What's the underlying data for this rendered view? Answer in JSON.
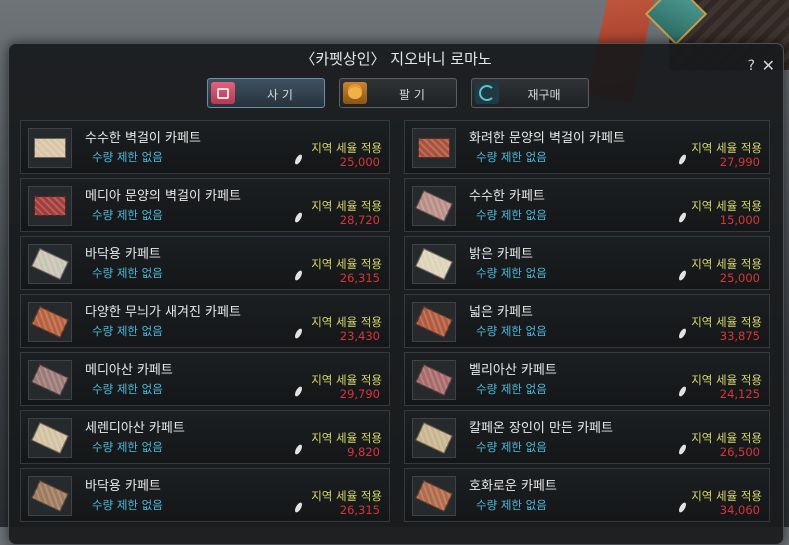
{
  "window": {
    "title": "〈카펫상인〉 지오바니 로마노",
    "help_label": "?",
    "close_label": "✕"
  },
  "tabs": [
    {
      "label": "사 기",
      "icon": "shopping-bag-icon",
      "active": true
    },
    {
      "label": "팔 기",
      "icon": "coins-icon",
      "active": false
    },
    {
      "label": "재구매",
      "icon": "repurchase-icon",
      "active": false
    }
  ],
  "items": [
    {
      "name": "수수한 벽걸이 카페트",
      "limit": "수량 제한 없음",
      "tax": "지역 세율 적용",
      "price": "25,000",
      "color": "#d9c6a8"
    },
    {
      "name": "화려한 문양의 벽걸이 카페트",
      "limit": "수량 제한 없음",
      "tax": "지역 세율 적용",
      "price": "27,990",
      "color": "#a8523c"
    },
    {
      "name": "메디아 문양의 벽걸이 카페트",
      "limit": "수량 제한 없음",
      "tax": "지역 세율 적용",
      "price": "28,720",
      "color": "#a33d3a"
    },
    {
      "name": "수수한 카페트",
      "limit": "수량 제한 없음",
      "tax": "지역 세율 적용",
      "price": "15,000",
      "color": "#b98e88"
    },
    {
      "name": "바닥용 카페트",
      "limit": "수량 제한 없음",
      "tax": "지역 세율 적용",
      "price": "26,315",
      "color": "#c9c3b4"
    },
    {
      "name": "밝은 카페트",
      "limit": "수량 제한 없음",
      "tax": "지역 세율 적용",
      "price": "25,000",
      "color": "#ddd3b8"
    },
    {
      "name": "다양한 무늬가 새겨진 카페트",
      "limit": "수량 제한 없음",
      "tax": "지역 세율 적용",
      "price": "23,430",
      "color": "#b9613e"
    },
    {
      "name": "넓은 카페트",
      "limit": "수량 제한 없음",
      "tax": "지역 세율 적용",
      "price": "33,875",
      "color": "#b25a3e"
    },
    {
      "name": "메디아산 카페트",
      "limit": "수량 제한 없음",
      "tax": "지역 세율 적용",
      "price": "29,790",
      "color": "#9c7a78"
    },
    {
      "name": "벨리아산 카페트",
      "limit": "수량 제한 없음",
      "tax": "지역 세율 적용",
      "price": "24,125",
      "color": "#a86a6a"
    },
    {
      "name": "세렌디아산 카페트",
      "limit": "수량 제한 없음",
      "tax": "지역 세율 적용",
      "price": "9,820",
      "color": "#d2c2a2"
    },
    {
      "name": "칼페온 장인이 만든 카페트",
      "limit": "수량 제한 없음",
      "tax": "지역 세율 적용",
      "price": "26,500",
      "color": "#c8b48e"
    },
    {
      "name": "바닥용 카페트",
      "limit": "수량 제한 없음",
      "tax": "지역 세율 적용",
      "price": "26,315",
      "color": "#9e7a5e"
    },
    {
      "name": "호화로운 카페트",
      "limit": "수량 제한 없음",
      "tax": "지역 세율 적용",
      "price": "34,060",
      "color": "#b06a4a"
    }
  ]
}
